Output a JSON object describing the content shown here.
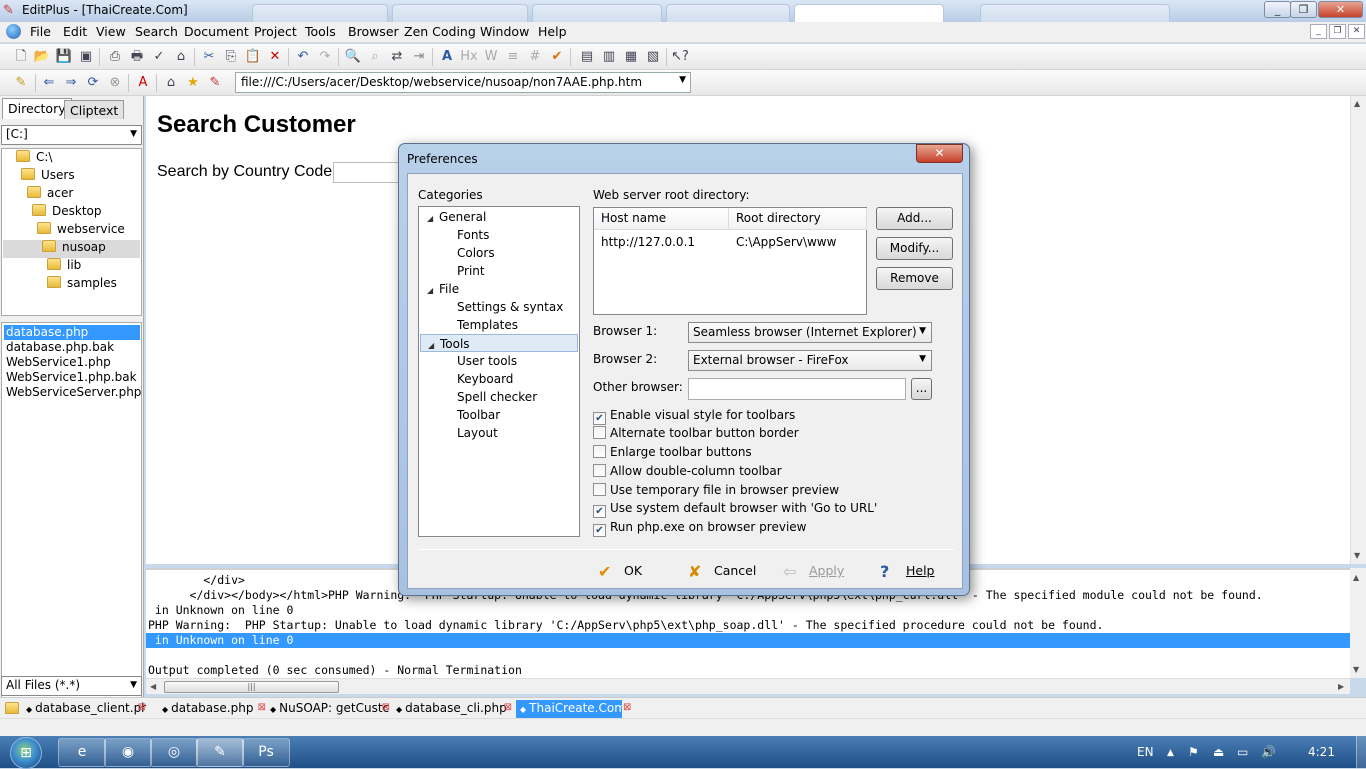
{
  "window": {
    "title": "EditPlus - [ThaiCreate.Com]",
    "ghost_tabs": [
      "",
      "",
      "",
      "",
      "",
      "",
      "",
      ""
    ]
  },
  "menu": [
    "File",
    "Edit",
    "View",
    "Search",
    "Document",
    "Project",
    "Tools",
    "Browser",
    "Zen Coding",
    "Window",
    "Help"
  ],
  "browser_bar": {
    "url": "file:///C:/Users/acer/Desktop/webservice/nusoap/non7AAE.php.htm"
  },
  "left_pane": {
    "tabs": [
      "Directory",
      "Cliptext"
    ],
    "drive": "[C:]",
    "tree": [
      {
        "label": "C:\\",
        "level": 0
      },
      {
        "label": "Users",
        "level": 1
      },
      {
        "label": "acer",
        "level": 2
      },
      {
        "label": "Desktop",
        "level": 3
      },
      {
        "label": "webservice",
        "level": 4
      },
      {
        "label": "nusoap",
        "level": 5,
        "selected": true
      },
      {
        "label": "lib",
        "level": 6
      },
      {
        "label": "samples",
        "level": 6
      }
    ],
    "files": [
      {
        "name": "database.php",
        "selected": true
      },
      {
        "name": "database.php.bak"
      },
      {
        "name": "WebService1.php"
      },
      {
        "name": "WebService1.php.bak"
      },
      {
        "name": "WebServiceServer.php"
      }
    ],
    "filter": "All Files (*.*)"
  },
  "document": {
    "heading": "Search Customer",
    "label": "Search by Country Code"
  },
  "output": {
    "lines": [
      "        </div>",
      "      </div></body></html>PHP Warning:  PHP Startup: Unable to load dynamic library 'C:/AppServ\\php5\\ext\\php_curl.dll' - The specified module could not be found.",
      " in Unknown on line 0",
      "PHP Warning:  PHP Startup: Unable to load dynamic library 'C:/AppServ\\php5\\ext\\php_soap.dll' - The specified procedure could not be found.",
      " in Unknown on line 0",
      "",
      "Output completed (0 sec consumed) - Normal Termination"
    ],
    "selected_line": 4
  },
  "doc_tabs": [
    {
      "label": "database_client.ph",
      "active": false
    },
    {
      "label": "database.php",
      "active": false
    },
    {
      "label": "NuSOAP: getCustc",
      "active": false
    },
    {
      "label": "database_cli.php",
      "active": false
    },
    {
      "label": "ThaiCreate.Com",
      "active": true
    }
  ],
  "taskbar": {
    "lang": "EN",
    "clock": "4:21"
  },
  "dialog": {
    "title": "Preferences",
    "categories_label": "Categories",
    "categories": [
      {
        "label": "General",
        "level": 0,
        "expanded": true
      },
      {
        "label": "Fonts",
        "level": 1
      },
      {
        "label": "Colors",
        "level": 1
      },
      {
        "label": "Print",
        "level": 1
      },
      {
        "label": "File",
        "level": 0,
        "expanded": true
      },
      {
        "label": "Settings & syntax",
        "level": 1
      },
      {
        "label": "Templates",
        "level": 1
      },
      {
        "label": "Tools",
        "level": 0,
        "expanded": true,
        "selected": true
      },
      {
        "label": "User tools",
        "level": 1
      },
      {
        "label": "Keyboard",
        "level": 1
      },
      {
        "label": "Spell checker",
        "level": 1
      },
      {
        "label": "Toolbar",
        "level": 1
      },
      {
        "label": "Layout",
        "level": 1
      }
    ],
    "webroot_label": "Web server root directory:",
    "table_headers": [
      "Host name",
      "Root directory"
    ],
    "table_rows": [
      [
        "http://127.0.0.1",
        "C:\\AppServ\\www"
      ]
    ],
    "side_buttons": [
      "Add...",
      "Modify...",
      "Remove"
    ],
    "browser1_label": "Browser 1:",
    "browser1_value": "Seamless browser (Internet Explorer)",
    "browser2_label": "Browser 2:",
    "browser2_value": "External browser - FireFox",
    "other_label": "Other browser:",
    "other_value": "",
    "browse_button": "...",
    "options": [
      {
        "label": "Enable visual style for toolbars",
        "checked": true
      },
      {
        "label": "Alternate toolbar button border",
        "checked": false
      },
      {
        "label": "Enlarge toolbar buttons",
        "checked": false
      },
      {
        "label": "Allow double-column toolbar",
        "checked": false
      },
      {
        "label": "Use temporary file in browser preview",
        "checked": false
      },
      {
        "label": "Use system default browser with 'Go to URL'",
        "checked": true
      },
      {
        "label": "Run php.exe on browser preview",
        "checked": true
      }
    ],
    "footer": {
      "ok": "OK",
      "cancel": "Cancel",
      "apply": "Apply",
      "help": "Help"
    }
  }
}
